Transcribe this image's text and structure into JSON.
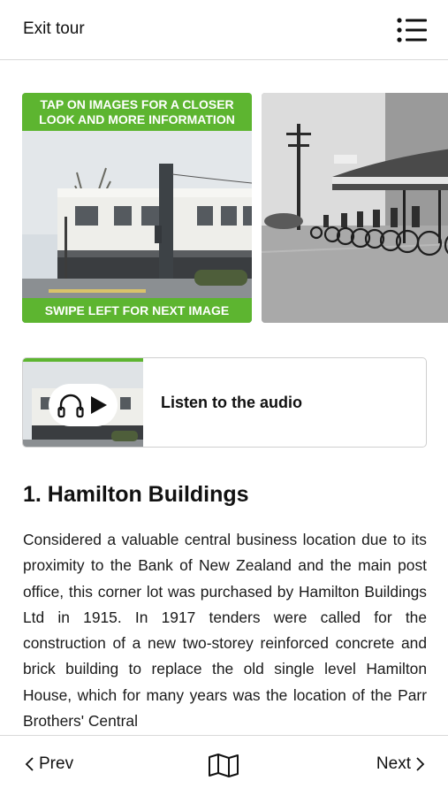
{
  "header": {
    "exit_label": "Exit tour",
    "menu_icon": "list-menu-icon"
  },
  "gallery": {
    "tap_banner": "TAP ON IMAGES FOR A CLOSER LOOK AND MORE INFORMATION",
    "swipe_banner": "SWIPE LEFT FOR NEXT IMAGE",
    "accent_color": "#5db530"
  },
  "audio": {
    "label": "Listen to the audio",
    "icons": [
      "headphones-icon",
      "play-icon"
    ]
  },
  "article": {
    "title": "1. Hamilton Buildings",
    "body": "Considered a valuable central business location due to its proximity to the Bank of New Zealand and the main post office, this corner lot was purchased by Hamilton Buildings Ltd in 1915. In 1917 tenders were called for the construction of a new two-storey reinforced concrete and brick building to replace the old single level Hamilton House, which for many years was the location of the Parr Brothers' Central"
  },
  "footer": {
    "prev_label": "Prev",
    "next_label": "Next",
    "map_icon": "map-icon"
  }
}
